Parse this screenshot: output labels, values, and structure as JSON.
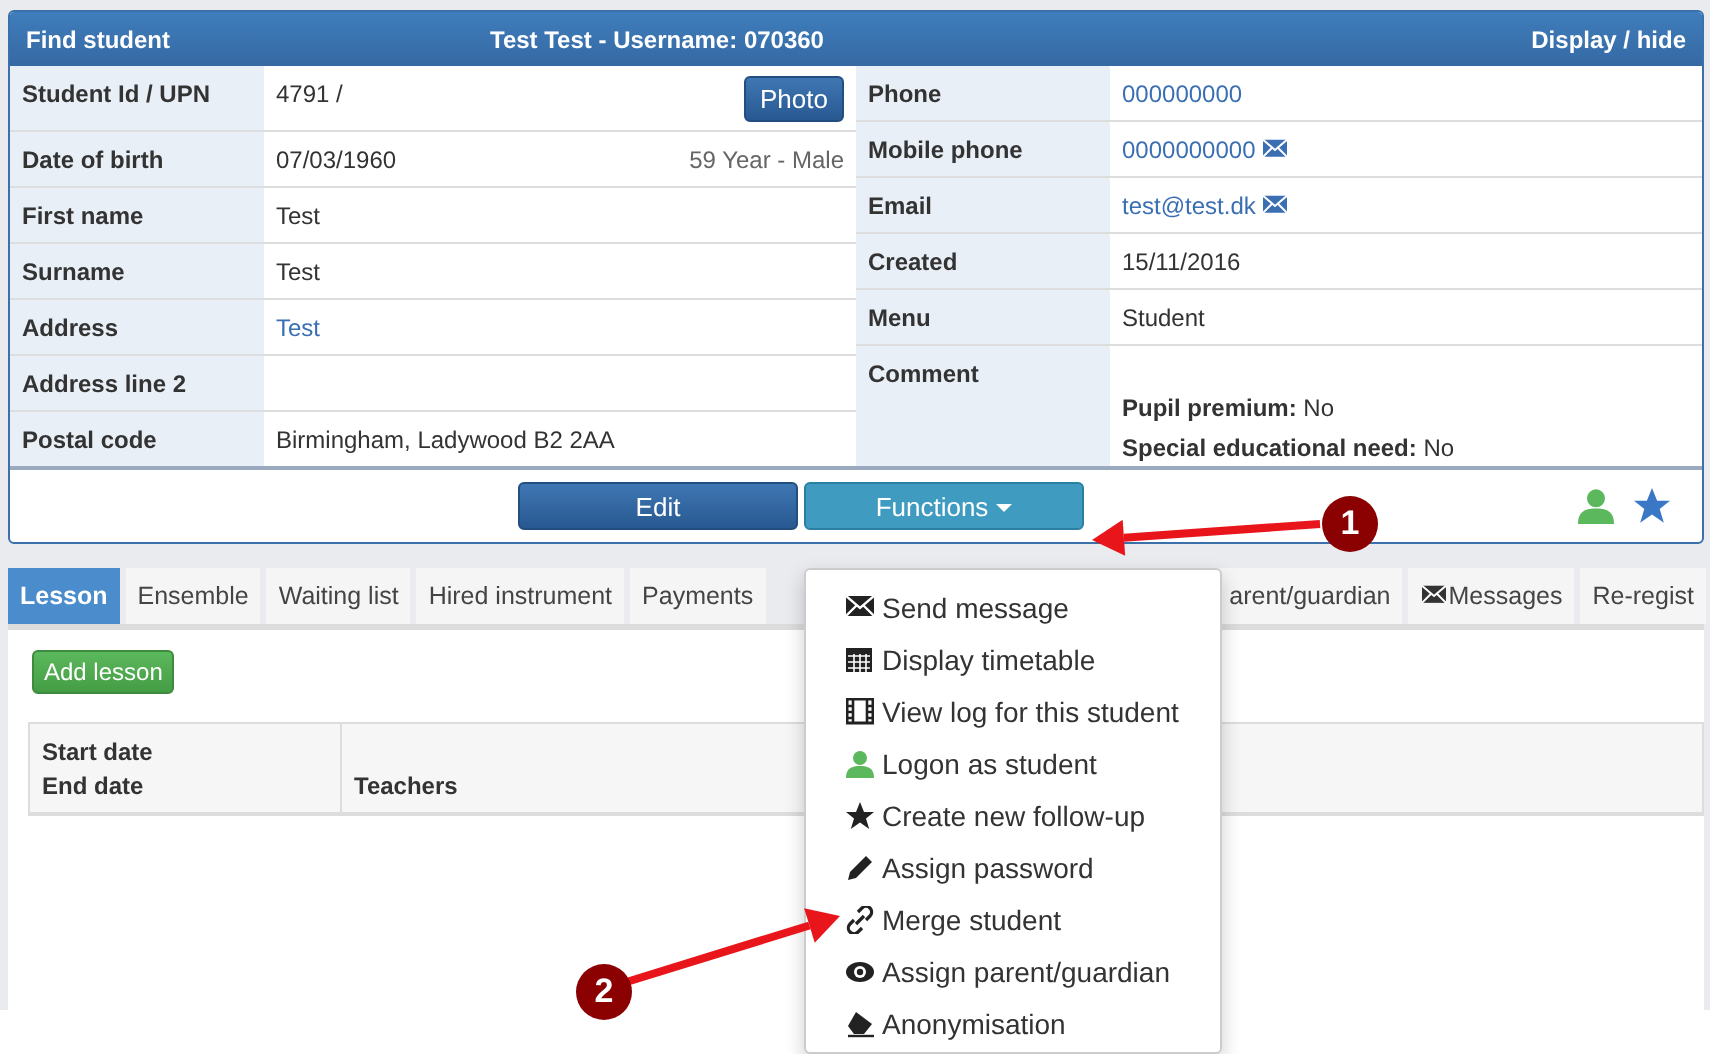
{
  "header": {
    "title": "Find student",
    "student": "Test Test - Username: **070360**",
    "toggle": "Display / hide"
  },
  "details_left": [
    {
      "label": "Student Id / UPN",
      "value": "4791 /",
      "button": "Photo"
    },
    {
      "label": "Date of birth",
      "value": "07/03/1960",
      "extra": "59 Year - Male"
    },
    {
      "label": "First name",
      "value": "Test"
    },
    {
      "label": "Surname",
      "value": "Test"
    },
    {
      "label": "Address",
      "value": "Test",
      "kind": "link"
    },
    {
      "label": "Address line 2"
    },
    {
      "label": "Postal code",
      "value": "Birmingham, Ladywood B2 2AA"
    }
  ],
  "details_right": [
    {
      "label": "Phone",
      "value": "000000000",
      "kind": "link"
    },
    {
      "label": "Mobile phone",
      "value": "0000000000",
      "kind": "mail-link"
    },
    {
      "label": "Email",
      "value": "test@test.dk",
      "kind": "mail-link"
    },
    {
      "label": "Created",
      "value": "15/11/2016"
    },
    {
      "label": "Menu",
      "value": "Student"
    },
    {
      "label": "Comment",
      "lines": [
        "**Pupil premium:** No",
        "**Special educational need:** No"
      ]
    }
  ],
  "actions": {
    "edit": "Edit",
    "functions": "Functions"
  },
  "tabs": [
    {
      "label": "Lesson",
      "selected": true
    },
    {
      "label": "Ensemble",
      "selected": false
    },
    {
      "label": "Waiting list",
      "selected": false
    },
    {
      "label": "Hired instrument",
      "selected": false
    },
    {
      "label": "Payments",
      "selected": false
    },
    {
      "label": "arent/guardian",
      "selected": false,
      "partly_hidden": true
    },
    {
      "label": "Messages",
      "selected": false,
      "kind": "mail"
    },
    {
      "label": "Re-regist",
      "selected": false
    }
  ],
  "add_button": "Add lesson",
  "table": {
    "columns": [
      [
        "Start date",
        "End date"
      ],
      [
        "Teachers"
      ]
    ]
  },
  "menu": [
    "Send message",
    "Display timetable",
    "View log for this student",
    "Logon as student",
    "Create new follow-up",
    "Assign password",
    "Merge student",
    "Assign parent/guardian",
    "Anonymisation"
  ],
  "annotations": [
    {
      "label": "1"
    },
    {
      "label": "2"
    }
  ]
}
